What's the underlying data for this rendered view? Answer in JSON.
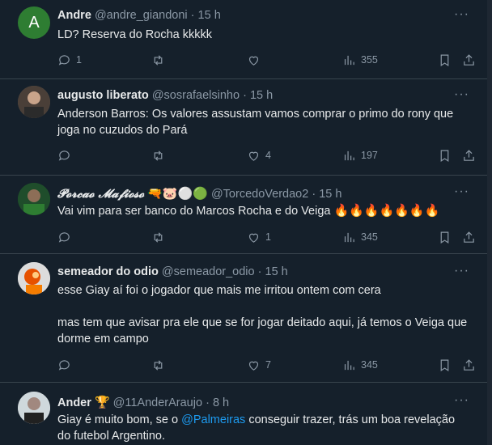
{
  "tweets": [
    {
      "name": "Andre",
      "badge": "",
      "handle": "@andre_giandoni",
      "time": "15 h",
      "avatar_letter": "A",
      "text": "LD? Reserva do Rocha kkkkk",
      "replies": "1",
      "retweets": "",
      "likes": "",
      "views": "355"
    },
    {
      "name": "augusto liberato",
      "badge": "",
      "handle": "@sosrafaelsinho",
      "time": "15 h",
      "text": "Anderson Barros: Os valores assustam vamos comprar o primo do rony que joga no cuzudos do Pará",
      "replies": "",
      "retweets": "",
      "likes": "4",
      "views": "197"
    },
    {
      "name": "𝓟𝓸𝓻𝓬𝓪𝓸 𝓜𝓪𝓯𝓲𝓸𝓼𝓸",
      "badge": "🔫🐷⚪🟢",
      "handle": "@TorcedoVerdao2",
      "time": "15 h",
      "text": "Vai vim para ser banco do Marcos Rocha e do Veiga",
      "text_emoji": "🔥🔥🔥🔥🔥🔥🔥",
      "replies": "",
      "retweets": "",
      "likes": "1",
      "views": "345"
    },
    {
      "name": "semeador do odio",
      "badge": "",
      "handle": "@semeador_odio",
      "time": "15 h",
      "text": "esse Giay aí foi o jogador que mais me irritou ontem com cera",
      "text2": "mas tem que avisar pra ele que se for jogar deitado aqui, já temos o Veiga que dorme em campo",
      "replies": "",
      "retweets": "",
      "likes": "7",
      "views": "345"
    },
    {
      "name": "Ander",
      "badge": "🏆",
      "handle": "@11AnderAraujo",
      "time": "8 h",
      "text_a": "Giay é muito bom, se o ",
      "mention": "@Palmeiras",
      "text_b": " conseguir trazer, trás um boa revelação do futebol Argentino."
    }
  ],
  "ui": {
    "dot": "·",
    "more": "···"
  },
  "colors": {
    "background": "#15202b",
    "text": "#e7e9ea",
    "muted": "#8b98a5",
    "accent": "#1d9bf0",
    "avatar_green": "#2e7d32"
  },
  "icons": [
    "reply-icon",
    "retweet-icon",
    "like-icon",
    "views-icon",
    "bookmark-icon",
    "share-icon",
    "more-icon"
  ]
}
